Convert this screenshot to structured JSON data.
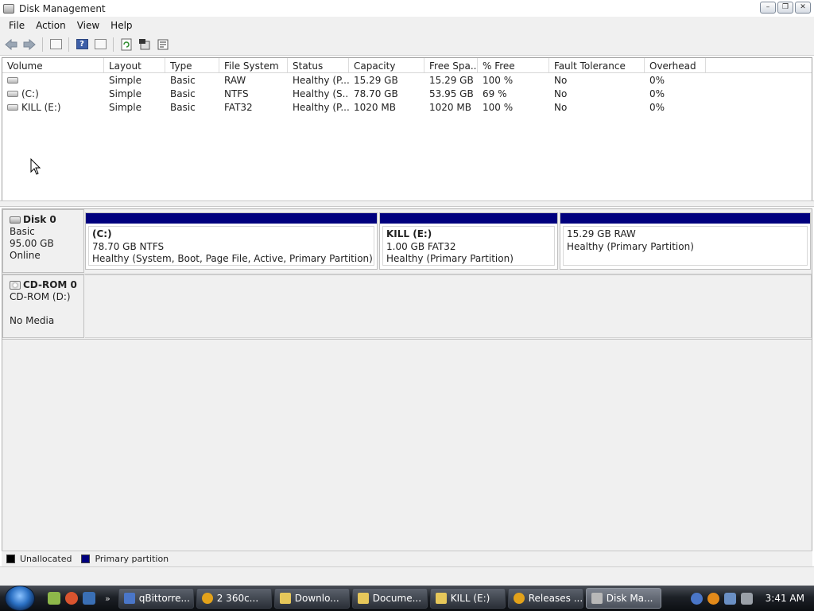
{
  "window": {
    "title": "Disk Management"
  },
  "window_buttons": {
    "minimize": "–",
    "maximize": "❐",
    "close": "✕"
  },
  "menu": [
    "File",
    "Action",
    "View",
    "Help"
  ],
  "toolbar": {
    "back_icon": "back-arrow-icon",
    "forward_icon": "forward-arrow-icon",
    "help_glyph": "?"
  },
  "volume_list": {
    "columns": [
      "Volume",
      "Layout",
      "Type",
      "File System",
      "Status",
      "Capacity",
      "Free Spa...",
      "% Free",
      "Fault Tolerance",
      "Overhead"
    ],
    "rows": [
      {
        "volume": "",
        "layout": "Simple",
        "type": "Basic",
        "fs": "RAW",
        "status": "Healthy (P...",
        "capacity": "15.29 GB",
        "free": "15.29 GB",
        "pct": "100 %",
        "fault": "No",
        "overhead": "0%"
      },
      {
        "volume": "(C:)",
        "layout": "Simple",
        "type": "Basic",
        "fs": "NTFS",
        "status": "Healthy (S...",
        "capacity": "78.70 GB",
        "free": "53.95 GB",
        "pct": "69 %",
        "fault": "No",
        "overhead": "0%"
      },
      {
        "volume": "KILL (E:)",
        "layout": "Simple",
        "type": "Basic",
        "fs": "FAT32",
        "status": "Healthy (P...",
        "capacity": "1020 MB",
        "free": "1020 MB",
        "pct": "100 %",
        "fault": "No",
        "overhead": "0%"
      }
    ]
  },
  "disks": [
    {
      "name": "Disk 0",
      "type": "Basic",
      "size": "95.00 GB",
      "state": "Online",
      "partitions": [
        {
          "name": "(C:)",
          "size": "78.70 GB NTFS",
          "status": "Healthy (System, Boot, Page File, Active, Primary Partition)"
        },
        {
          "name": "KILL  (E:)",
          "size": "1.00 GB FAT32",
          "status": "Healthy (Primary Partition)"
        },
        {
          "name": "",
          "size": "15.29 GB RAW",
          "status": "Healthy (Primary Partition)"
        }
      ]
    },
    {
      "name": "CD-ROM 0",
      "type": "CD-ROM (D:)",
      "media": "No Media"
    }
  ],
  "legend": [
    {
      "label": "Unallocated",
      "color": "#000000"
    },
    {
      "label": "Primary partition",
      "color": "#00007e"
    }
  ],
  "colors": {
    "partition_bar": "#00007e"
  },
  "taskbar": {
    "more_glyph": "»",
    "tasks": [
      {
        "label": "qBittorre...",
        "icon": "qbittorrent-icon",
        "color": "#4a76c8"
      },
      {
        "label": "2 360c...",
        "icon": "chrome-icon",
        "color": "#e3a21a"
      },
      {
        "label": "Downlo...",
        "icon": "folder-icon",
        "color": "#e6c75a"
      },
      {
        "label": "Docume...",
        "icon": "folder-icon",
        "color": "#e6c75a"
      },
      {
        "label": "KILL (E:)",
        "icon": "folder-icon",
        "color": "#e6c75a"
      },
      {
        "label": "Releases ...",
        "icon": "chrome-icon",
        "color": "#e3a21a"
      },
      {
        "label": "Disk Ma...",
        "icon": "disk-management-icon",
        "color": "#b8b8b8"
      }
    ],
    "clock": "3:41 AM"
  }
}
